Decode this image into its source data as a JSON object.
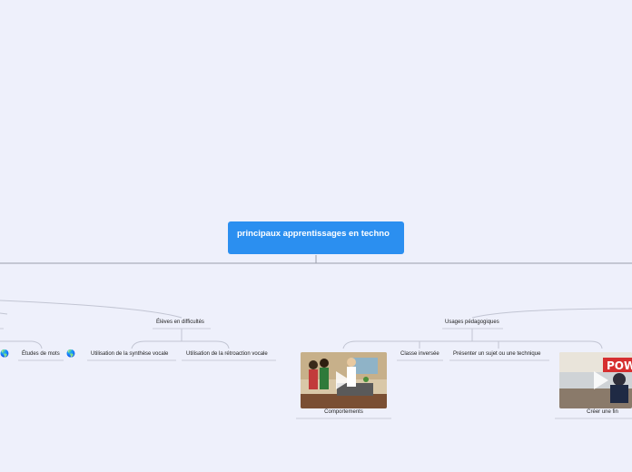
{
  "map": {
    "root": "principaux apprentissages en techno",
    "branches": {
      "eleves": "Élèves en difficultés",
      "usages": "Usages pédagogiques"
    },
    "topics": {
      "etudes_mots": "Études de mots",
      "synthese": "Utilisation de la synthèse vocale",
      "retroaction": "Utilisation de la rétroaction vocale",
      "classe_inversee": "Classe inversée",
      "presenter": "Présenter un sujet ou une technique"
    },
    "videos": {
      "comportements": "Comportements",
      "creer_fin": "Créer une fin"
    },
    "icons": {
      "link": "globe-icon",
      "play": "play-icon"
    },
    "colors": {
      "root": "#2b8ff0",
      "background": "#eef0fb",
      "connector": "#b9bccb"
    }
  }
}
